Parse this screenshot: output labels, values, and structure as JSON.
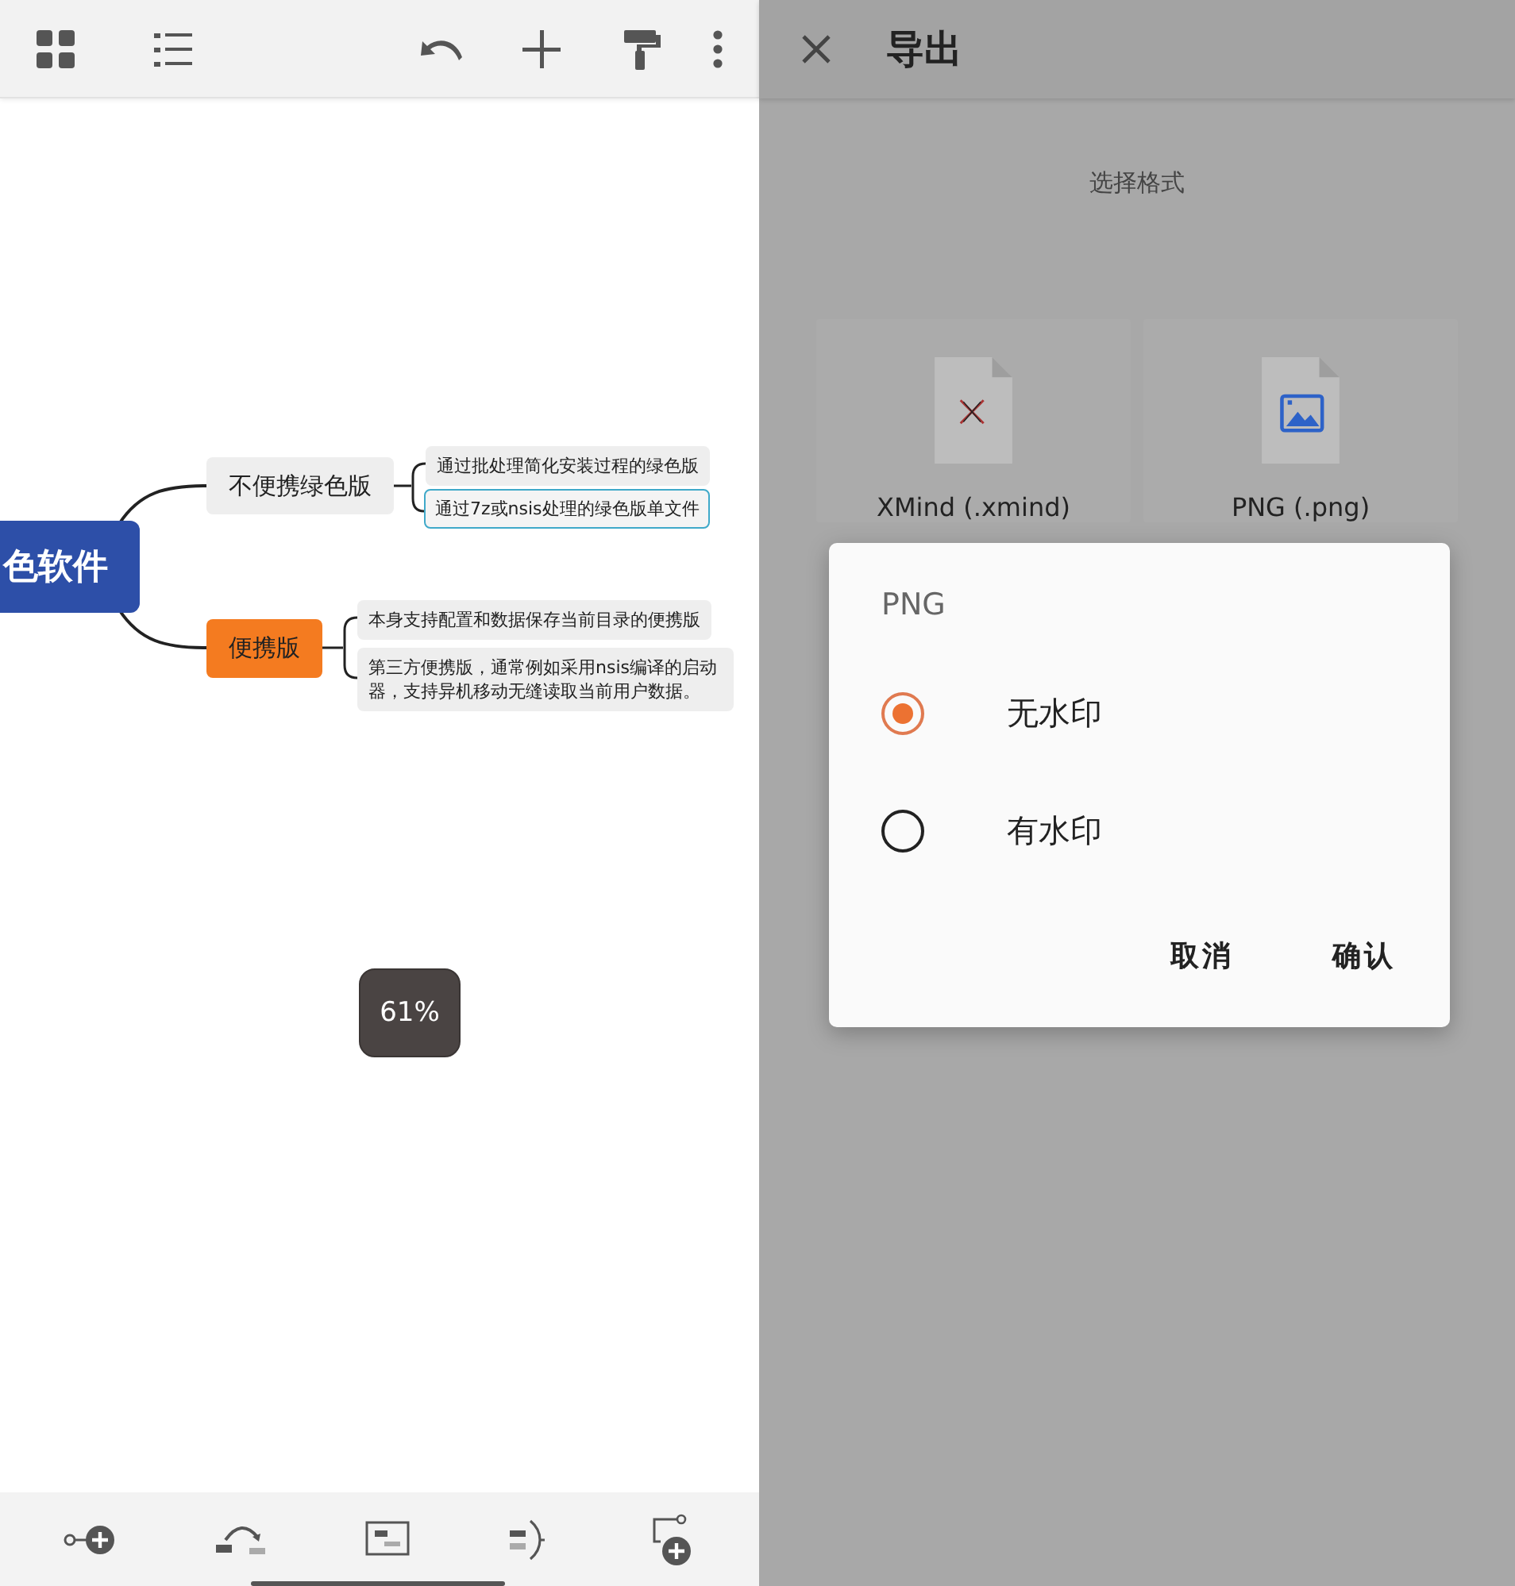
{
  "mind_map": {
    "root": "色软件",
    "branches": [
      {
        "label": "不便携绿色版",
        "color": "#eeeeee",
        "leaves": [
          {
            "label": "通过批处理简化安装过程的绿色版",
            "selected": false
          },
          {
            "label": "通过7z或nsis处理的绿色版单文件",
            "selected": true
          }
        ]
      },
      {
        "label": "便携版",
        "color": "#f47b20",
        "leaves": [
          {
            "label": "本身支持配置和数据保存当前目录的便携版",
            "selected": false
          },
          {
            "label": "第三方便携版，通常例如采用nsis编译的启动器，支持异机移动无缝读取当前用户数据。",
            "selected": false
          }
        ]
      }
    ],
    "zoom": "61%"
  },
  "export": {
    "title": "导出",
    "subtitle": "选择格式",
    "formats": [
      {
        "label": "XMind (.xmind)",
        "kind": "xmind"
      },
      {
        "label": "PNG (.png)",
        "kind": "png"
      }
    ]
  },
  "dialog": {
    "title": "PNG",
    "options": [
      {
        "label": "无水印",
        "selected": true
      },
      {
        "label": "有水印",
        "selected": false
      }
    ],
    "buttons": [
      "取消",
      "确认"
    ]
  }
}
